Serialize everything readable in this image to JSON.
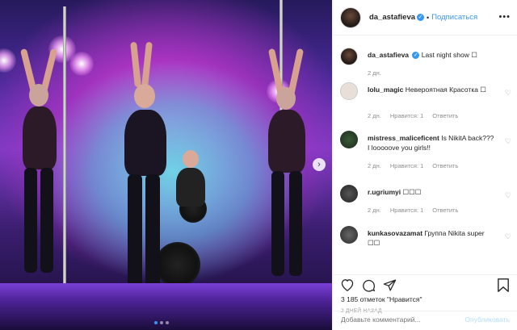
{
  "post": {
    "username": "da_astafieva",
    "follow_label": "Подписаться",
    "separator": "•",
    "caption": "Last night show ☐",
    "caption_time": "2 дн.",
    "likes": "3 185 отметок \"Нравится\"",
    "date": "2 ДНЕЙ НАЗАД",
    "comment_placeholder": "Добавьте комментарий...",
    "publish_label": "Опубликовать"
  },
  "comments": [
    {
      "username": "lolu_magic",
      "text": "Невероятная Красотка ☐",
      "time": "2 дн.",
      "likes": "Нравится: 1",
      "reply": "Ответить"
    },
    {
      "username": "mistress_maliceficent",
      "text": "Is NikitA back??? I looooove you girls!!",
      "time": "2 дн.",
      "likes": "Нравится: 1",
      "reply": "Ответить"
    },
    {
      "username": "r.ugriumyi",
      "text": "☐☐☐",
      "time": "2 дн.",
      "likes": "Нравится: 1",
      "reply": "Ответить"
    },
    {
      "username": "kunkasovazamat",
      "text": "Группа Nikita super ☐☐",
      "time": "",
      "likes": "",
      "reply": ""
    }
  ],
  "icons": {
    "verified": "verified-badge-icon",
    "more": "more-options-icon",
    "heart": "heart-icon",
    "comment": "comment-icon",
    "share": "share-icon",
    "save": "bookmark-icon",
    "next": "chevron-right-icon"
  },
  "colors": {
    "accent": "#3897f0",
    "muted": "#8e8e8e",
    "text": "#262626"
  }
}
